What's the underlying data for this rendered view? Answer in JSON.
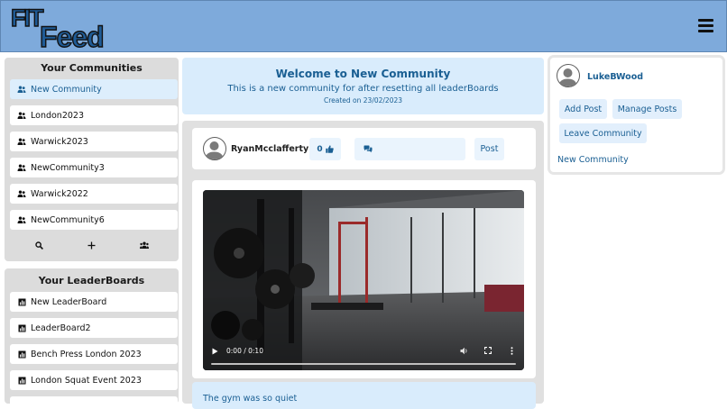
{
  "header": {
    "logo_text_top": "FIT",
    "logo_text_bottom": "Feed"
  },
  "communities": {
    "title": "Your Communities",
    "items": [
      {
        "label": "New Community",
        "active": true
      },
      {
        "label": "London2023"
      },
      {
        "label": "Warwick2023"
      },
      {
        "label": "NewCommunity3"
      },
      {
        "label": "Warwick2022"
      },
      {
        "label": "NewCommunity6"
      }
    ]
  },
  "leaderboards": {
    "title": "Your LeaderBoards",
    "items": [
      {
        "label": "New LeaderBoard"
      },
      {
        "label": "LeaderBoard2"
      },
      {
        "label": "Bench Press London 2023"
      },
      {
        "label": "London Squat Event 2023"
      }
    ]
  },
  "welcome": {
    "title": "Welcome to New Community",
    "description": "This is a new community for after resetting all leaderBoards",
    "created": "Created on 23/02/2023"
  },
  "post": {
    "username": "RyanMcclafferty",
    "likes": "0",
    "post_label": "Post",
    "video_time": "0:00 / 0:10",
    "caption": "The gym was so quiet"
  },
  "sidebar": {
    "username": "LukeBWood",
    "add_post": "Add Post",
    "manage_posts": "Manage Posts",
    "leave_community": "Leave Community",
    "community_link": "New Community"
  },
  "colors": {
    "accent": "#1a5f93",
    "header_bg": "#7eaadb",
    "active_bg": "#ddeefc",
    "panel_bg": "#dcdcdc"
  }
}
